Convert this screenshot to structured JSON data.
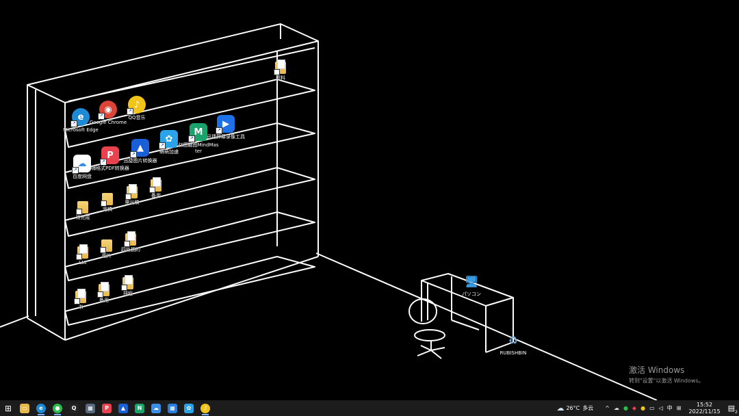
{
  "desktop": {
    "icons": [
      {
        "label": "资料",
        "kind": "folder"
      },
      {
        "label": "Microsoft Edge",
        "kind": "app",
        "color": "#1e8ad6",
        "glyph": "e"
      },
      {
        "label": "Google Chrome",
        "kind": "app",
        "color": "#db4437",
        "glyph": "◉"
      },
      {
        "label": "QQ音乐",
        "kind": "app",
        "color": "#f2c318",
        "glyph": "♪"
      },
      {
        "label": "迅捷屏幕录像工具",
        "kind": "app",
        "color": "#1d72e8",
        "glyph": "▶"
      },
      {
        "label": "亿图脑图MindMaster",
        "kind": "app",
        "color": "#1aa36b",
        "glyph": "M"
      },
      {
        "label": "萌萌加速",
        "kind": "app",
        "color": "#2aa3e8",
        "glyph": "✿"
      },
      {
        "label": "迅捷图片转换器",
        "kind": "app",
        "color": "#1a5fd6",
        "glyph": "▲"
      },
      {
        "label": "嗨格式PDF转换器",
        "kind": "app",
        "color": "#e8424f",
        "glyph": "P"
      },
      {
        "label": "百度网盘",
        "kind": "app",
        "color": "#ffffff",
        "glyph": "☁"
      },
      {
        "label": "备用",
        "kind": "folder"
      },
      {
        "label": "需出稿",
        "kind": "folder"
      },
      {
        "label": "完稿",
        "kind": "folder"
      },
      {
        "label": "待完成",
        "kind": "folder"
      },
      {
        "label": "四处拥的",
        "kind": "folder"
      },
      {
        "label": "图片",
        "kind": "folder"
      },
      {
        "label": "LIA",
        "kind": "folder"
      },
      {
        "label": "排程",
        "kind": "folder"
      },
      {
        "label": "备用",
        "kind": "folder"
      },
      {
        "label": "书",
        "kind": "folder"
      },
      {
        "label": "パソコン",
        "kind": "app",
        "color": "#3a9be0",
        "glyph": "🖥"
      },
      {
        "label": "RUBISHBIN",
        "kind": "app",
        "color": "#6aa8d8",
        "glyph": "♻"
      }
    ]
  },
  "activation": {
    "title": "激活 Windows",
    "subtitle": "转到\"设置\"以激活 Windows。"
  },
  "taskbar": {
    "apps": [
      {
        "name": "start",
        "glyph": "⊞",
        "color": "#1c1c1c"
      },
      {
        "name": "file-explorer",
        "glyph": "▭",
        "color": "#e8b84a"
      },
      {
        "name": "edge",
        "glyph": "e",
        "color": "#1e8ad6"
      },
      {
        "name": "wechat",
        "glyph": "●",
        "color": "#2dbd4c"
      },
      {
        "name": "qq",
        "glyph": "Q",
        "color": "#222222"
      },
      {
        "name": "calculator",
        "glyph": "▦",
        "color": "#5a6a80"
      },
      {
        "name": "pdf-converter",
        "glyph": "P",
        "color": "#e8424f"
      },
      {
        "name": "image-converter",
        "glyph": "▲",
        "color": "#1a5fd6"
      },
      {
        "name": "mindmaster",
        "glyph": "N",
        "color": "#1aa36b"
      },
      {
        "name": "baidu-netdisk",
        "glyph": "☁",
        "color": "#3a8ee6"
      },
      {
        "name": "calendar",
        "glyph": "▦",
        "color": "#2a7de1"
      },
      {
        "name": "accelerator",
        "glyph": "✿",
        "color": "#2aa3e8"
      },
      {
        "name": "qq-music",
        "glyph": "♪",
        "color": "#f2c318"
      }
    ],
    "weather": {
      "temp": "26°C",
      "condition": "多云"
    },
    "ime": "中",
    "clock": {
      "time": "15:52",
      "date": "2022/11/15"
    },
    "notification_count": "2"
  }
}
